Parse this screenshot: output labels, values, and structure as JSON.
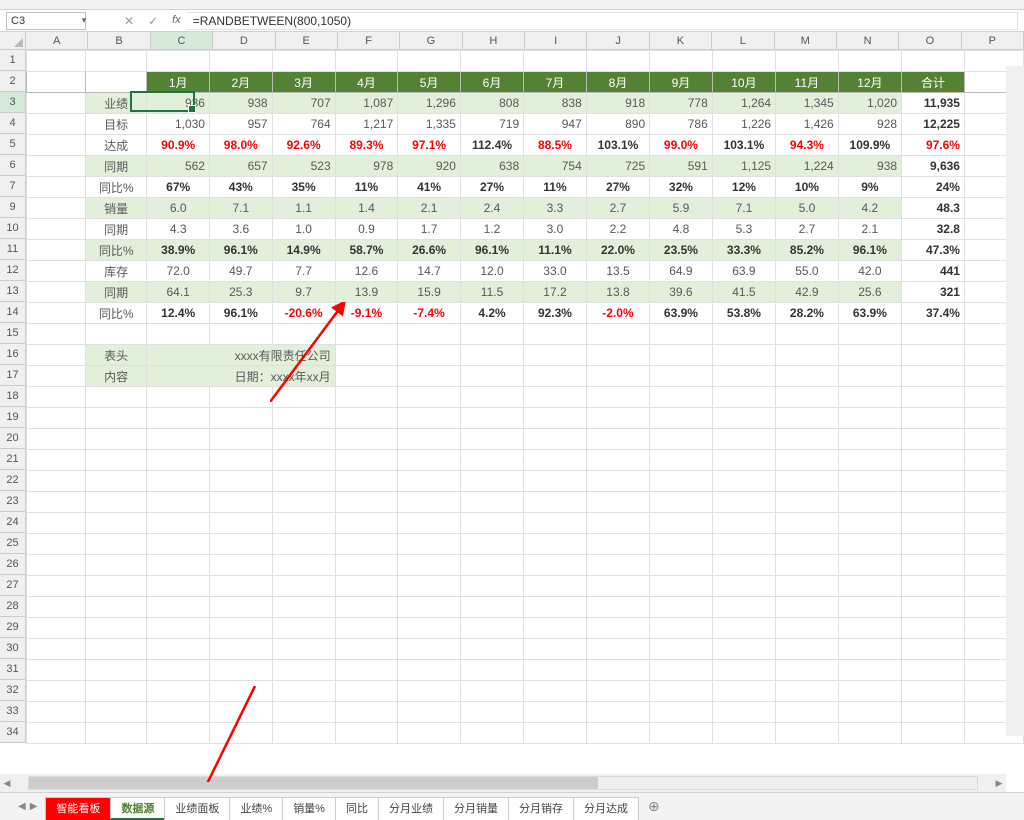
{
  "namebox": "C3",
  "formula": "=RANDBETWEEN(800,1050)",
  "columns": [
    "A",
    "B",
    "C",
    "D",
    "E",
    "F",
    "G",
    "H",
    "I",
    "J",
    "K",
    "L",
    "M",
    "N",
    "O",
    "P"
  ],
  "rows_display": [
    "1",
    "2",
    "3",
    "4",
    "5",
    "6",
    "7",
    "9",
    "10",
    "11",
    "12",
    "13",
    "14",
    "15",
    "16",
    "17",
    "18",
    "19",
    "20",
    "21",
    "22",
    "23",
    "24",
    "25",
    "26",
    "27",
    "28",
    "29",
    "30",
    "31",
    "32",
    "33",
    "34"
  ],
  "chart_data": {
    "type": "table",
    "months": [
      "1月",
      "2月",
      "3月",
      "4月",
      "5月",
      "6月",
      "7月",
      "8月",
      "9月",
      "10月",
      "11月",
      "12月"
    ],
    "total_label": "合计",
    "row_labels": {
      "perf": "业绩",
      "target": "目标",
      "achieve": "达成",
      "yoy1": "同期",
      "yoy1_pct": "同比%",
      "sales": "销量",
      "yoy2": "同期",
      "yoy2_pct": "同比%",
      "stock": "库存",
      "yoy3": "同期",
      "yoy3_pct": "同比%"
    },
    "perf": [
      "936",
      "938",
      "707",
      "1,087",
      "1,296",
      "808",
      "838",
      "918",
      "778",
      "1,264",
      "1,345",
      "1,020"
    ],
    "perf_total": "11,935",
    "target": [
      "1,030",
      "957",
      "764",
      "1,217",
      "1,335",
      "719",
      "947",
      "890",
      "786",
      "1,226",
      "1,426",
      "928"
    ],
    "target_total": "12,225",
    "achieve": [
      "90.9%",
      "98.0%",
      "92.6%",
      "89.3%",
      "97.1%",
      "112.4%",
      "88.5%",
      "103.1%",
      "99.0%",
      "103.1%",
      "94.3%",
      "109.9%"
    ],
    "achieve_total": "97.6%",
    "achieve_red": [
      true,
      true,
      true,
      true,
      true,
      false,
      true,
      false,
      true,
      false,
      true,
      false,
      true
    ],
    "yoy1": [
      "562",
      "657",
      "523",
      "978",
      "920",
      "638",
      "754",
      "725",
      "591",
      "1,125",
      "1,224",
      "938"
    ],
    "yoy1_total": "9,636",
    "yoy1_pct": [
      "67%",
      "43%",
      "35%",
      "11%",
      "41%",
      "27%",
      "11%",
      "27%",
      "32%",
      "12%",
      "10%",
      "9%"
    ],
    "yoy1_pct_total": "24%",
    "sales": [
      "6.0",
      "7.1",
      "1.1",
      "1.4",
      "2.1",
      "2.4",
      "3.3",
      "2.7",
      "5.9",
      "7.1",
      "5.0",
      "4.2"
    ],
    "sales_total": "48.3",
    "yoy2": [
      "4.3",
      "3.6",
      "1.0",
      "0.9",
      "1.7",
      "1.2",
      "3.0",
      "2.2",
      "4.8",
      "5.3",
      "2.7",
      "2.1"
    ],
    "yoy2_total": "32.8",
    "yoy2_pct": [
      "38.9%",
      "96.1%",
      "14.9%",
      "58.7%",
      "26.6%",
      "96.1%",
      "11.1%",
      "22.0%",
      "23.5%",
      "33.3%",
      "85.2%",
      "96.1%"
    ],
    "yoy2_pct_total": "47.3%",
    "stock": [
      "72.0",
      "49.7",
      "7.7",
      "12.6",
      "14.7",
      "12.0",
      "33.0",
      "13.5",
      "64.9",
      "63.9",
      "55.0",
      "42.0"
    ],
    "stock_total": "441",
    "yoy3": [
      "64.1",
      "25.3",
      "9.7",
      "13.9",
      "15.9",
      "11.5",
      "17.2",
      "13.8",
      "39.6",
      "41.5",
      "42.9",
      "25.6"
    ],
    "yoy3_total": "321",
    "yoy3_pct": [
      "12.4%",
      "96.1%",
      "-20.6%",
      "-9.1%",
      "-7.4%",
      "4.2%",
      "92.3%",
      "-2.0%",
      "63.9%",
      "53.8%",
      "28.2%",
      "63.9%"
    ],
    "yoy3_pct_total": "37.4%",
    "yoy3_pct_red": [
      false,
      false,
      true,
      true,
      true,
      false,
      false,
      true,
      false,
      false,
      false,
      false,
      false
    ]
  },
  "info": {
    "head_lbl": "表头",
    "head_val": "xxxx有限责任公司",
    "date_lbl": "内容",
    "date_val": "日期：xxxx年xx月"
  },
  "sheet_tabs": [
    "智能看板",
    "数据源",
    "业绩面板",
    "业绩%",
    "销量%",
    "同比",
    "分月业绩",
    "分月销量",
    "分月销存",
    "分月达成"
  ],
  "active_tab_index": 1
}
